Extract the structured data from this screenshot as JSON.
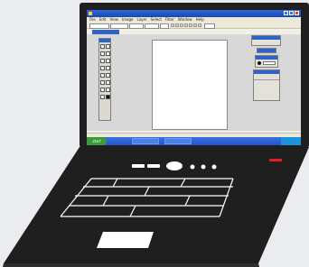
{
  "window": {
    "title": "",
    "controls": [
      "minimize",
      "maximize",
      "close"
    ]
  },
  "menubar": {
    "items": [
      "File",
      "Edit",
      "View",
      "Image",
      "Layer",
      "Select",
      "Filter",
      "Window",
      "Help"
    ]
  },
  "document": {
    "tab_label": ""
  },
  "toolbox": {
    "tools": [
      "move-icon",
      "marquee-icon",
      "lasso-icon",
      "wand-icon",
      "crop-icon",
      "brush-icon",
      "pencil-icon",
      "eraser-icon",
      "fill-icon",
      "gradient-icon",
      "text-icon",
      "shape-icon",
      "eyedropper-icon",
      "zoom-icon",
      "hand-icon",
      "color-swatch"
    ]
  },
  "panels": {
    "navigator": {
      "text": ""
    },
    "layers": {
      "rows": [
        "",
        "",
        ""
      ]
    }
  },
  "statusbar": {
    "text": ""
  },
  "taskbar": {
    "start_label": "start",
    "items": [
      "",
      ""
    ],
    "clock": ""
  },
  "colors": {
    "laptop_body": "#1f1f1f",
    "titlebar_blue": "#2f6ad8",
    "taskbar_blue": "#2455c8",
    "start_green": "#3c9a3c",
    "power_led": "#e02020"
  },
  "laptop": {
    "keyboard_rows": 5,
    "indicator_lights": 3
  }
}
